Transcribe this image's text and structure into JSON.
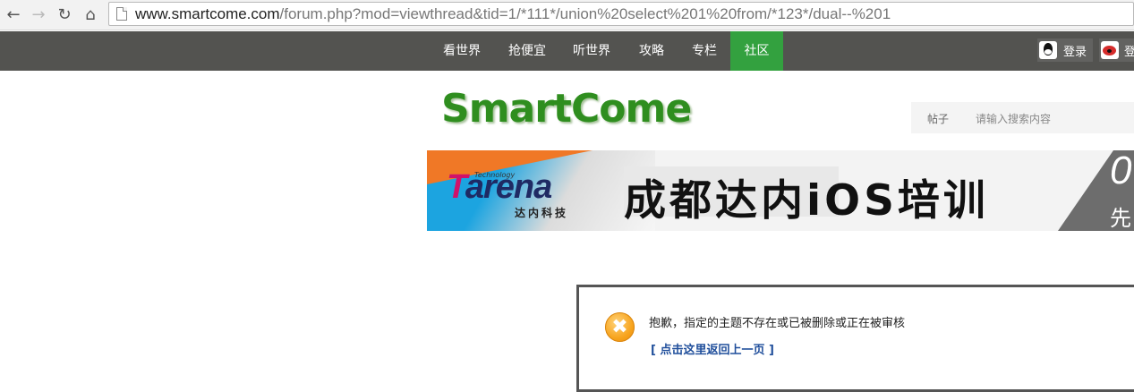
{
  "browser": {
    "url_host": "www.smartcome.com",
    "url_rest": "/forum.php?mod=viewthread&tid=1/*111*/union%20select%201%20from/*123*/dual--%201",
    "back_icon": "arrow-left",
    "forward_icon": "arrow-right",
    "reload_icon": "reload",
    "home_icon": "home"
  },
  "nav": {
    "items": [
      {
        "label": "看世界"
      },
      {
        "label": "抢便宜"
      },
      {
        "label": "听世界"
      },
      {
        "label": "攻略"
      },
      {
        "label": "专栏"
      },
      {
        "label": "社区"
      }
    ],
    "active_index": 5,
    "login_qq": "登录",
    "login_weibo": "登"
  },
  "site": {
    "logo": "SmartCome",
    "search_tab": "帖子",
    "search_placeholder": "请输入搜索内容"
  },
  "banner": {
    "tech": "Technology",
    "brand_t": "T",
    "brand_rest": "arena",
    "brand_cn": "达内科技",
    "headline": "成都达内iOS培训",
    "cut1": "0",
    "cut2": "先"
  },
  "alert": {
    "message": "抱歉，指定的主题不存在或已被删除或正在被审核",
    "link": "[ 点击这里返回上一页 ]"
  },
  "colors": {
    "nav_bg": "#535350",
    "nav_active": "#33a13f",
    "logo_green": "#2f8e1f",
    "link_blue": "#1f4e9b"
  }
}
